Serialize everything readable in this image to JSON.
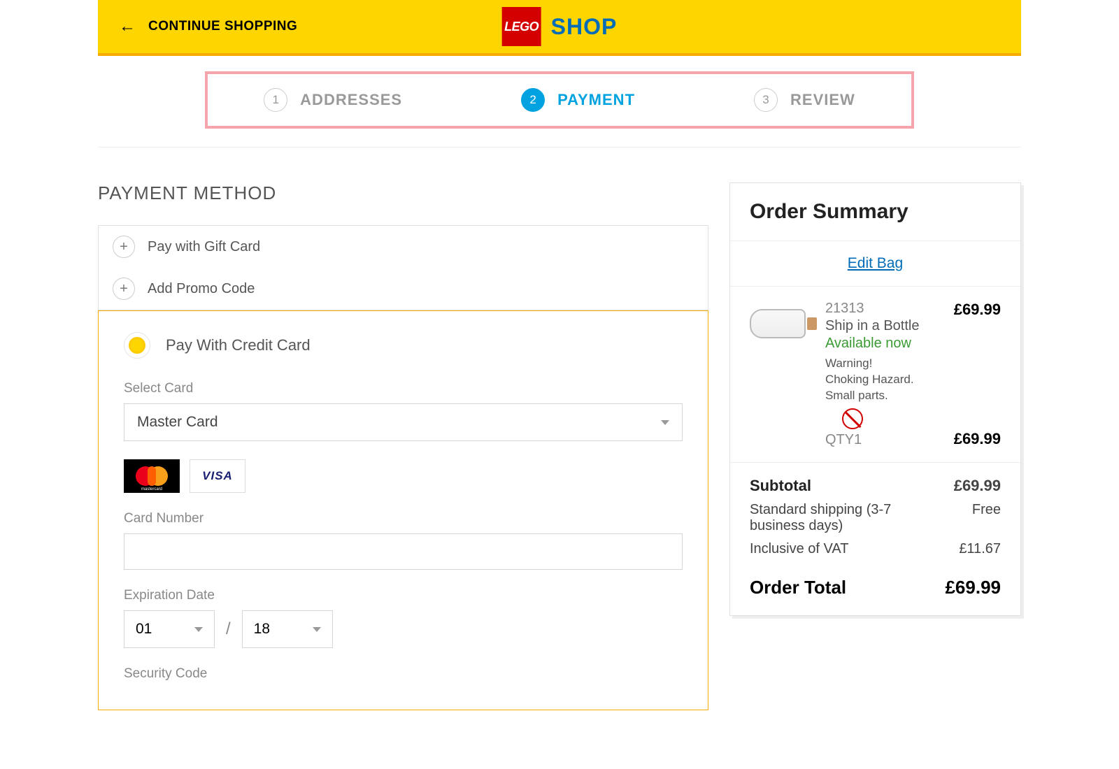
{
  "header": {
    "continue_label": "CONTINUE SHOPPING",
    "brand_logo_text": "LEGO",
    "brand_word": "SHOP"
  },
  "steps": [
    {
      "num": "1",
      "label": "ADDRESSES"
    },
    {
      "num": "2",
      "label": "PAYMENT"
    },
    {
      "num": "3",
      "label": "REVIEW"
    }
  ],
  "active_step": 1,
  "payment": {
    "section_title": "PAYMENT METHOD",
    "gift_card_label": "Pay with Gift Card",
    "promo_label": "Add Promo Code",
    "credit_card_label": "Pay With Credit Card",
    "select_card_label": "Select Card",
    "selected_card": "Master Card",
    "visa_text": "VISA",
    "mastercard_text": "mastercard",
    "card_number_label": "Card Number",
    "card_number_value": "",
    "expiration_label": "Expiration Date",
    "exp_month": "01",
    "exp_year": "18",
    "exp_separator": "/",
    "security_code_label": "Security Code"
  },
  "summary": {
    "title": "Order Summary",
    "edit_bag": "Edit Bag",
    "item": {
      "sku": "21313",
      "name": "Ship in a Bottle",
      "availability": "Available now",
      "warning_l1": "Warning!",
      "warning_l2": "Choking Hazard.",
      "warning_l3": "Small parts.",
      "qty_label": "QTY1",
      "unit_price": "£69.99",
      "line_price": "£69.99"
    },
    "subtotal_label": "Subtotal",
    "subtotal_value": "£69.99",
    "shipping_label": "Standard shipping (3-7 business days)",
    "shipping_value": "Free",
    "vat_label": "Inclusive of VAT",
    "vat_value": "£11.67",
    "order_total_label": "Order Total",
    "order_total_value": "£69.99"
  }
}
